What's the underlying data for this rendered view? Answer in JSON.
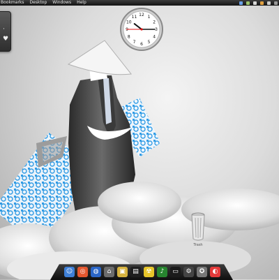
{
  "menubar": {
    "items": [
      "Bookmarks",
      "Desktop",
      "Windows",
      "Help"
    ]
  },
  "clock": {
    "time": "10:15:45",
    "numerals": [
      "12",
      "1",
      "2",
      "3",
      "4",
      "5",
      "6",
      "7",
      "8",
      "9",
      "10",
      "11"
    ]
  },
  "trash": {
    "label": "Trash"
  },
  "dock": {
    "items": [
      {
        "name": "finder-icon",
        "color": "#3e7fd6",
        "glyph": "☺"
      },
      {
        "name": "browser-icon",
        "color": "#e4572e",
        "glyph": "◎"
      },
      {
        "name": "globe-icon",
        "color": "#2b66c8",
        "glyph": "◍"
      },
      {
        "name": "home-icon",
        "color": "#6c6c6c",
        "glyph": "⌂"
      },
      {
        "name": "photos-icon",
        "color": "#d6b23e",
        "glyph": "▣"
      },
      {
        "name": "movie-icon",
        "color": "#1e1e1e",
        "glyph": "▤"
      },
      {
        "name": "radiation-icon",
        "color": "#e6c52a",
        "glyph": "☢"
      },
      {
        "name": "music-icon",
        "color": "#27852f",
        "glyph": "♪"
      },
      {
        "name": "terminal-icon",
        "color": "#1b1b1b",
        "glyph": "▭"
      },
      {
        "name": "system-icon",
        "color": "#444444",
        "glyph": "⚙"
      },
      {
        "name": "settings-icon",
        "color": "#777777",
        "glyph": "✪"
      },
      {
        "name": "color-icon",
        "color": "#e53a3a",
        "glyph": "◐"
      }
    ]
  }
}
